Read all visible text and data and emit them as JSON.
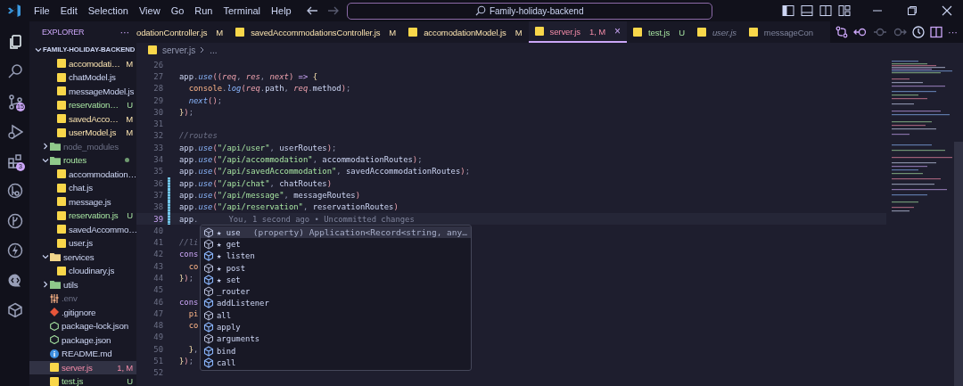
{
  "title_bar": {
    "menu": [
      "File",
      "Edit",
      "Selection",
      "View",
      "Go",
      "Run",
      "Terminal",
      "Help"
    ],
    "search": "Family-holiday-backend"
  },
  "activity_bar": [
    {
      "kind": "files",
      "selected": true
    },
    {
      "kind": "search",
      "selected": false
    },
    {
      "kind": "branch",
      "selected": false,
      "badge": "15"
    },
    {
      "kind": "debug",
      "selected": false
    },
    {
      "kind": "extensions",
      "selected": false,
      "badge": "3"
    },
    {
      "kind": "remote",
      "selected": false
    },
    {
      "kind": "graph",
      "selected": false
    },
    {
      "kind": "lightning",
      "selected": false
    },
    {
      "kind": "bubble",
      "selected": false
    },
    {
      "kind": "gem",
      "selected": false
    }
  ],
  "sidebar": {
    "title": "EXPLORER",
    "more": "···",
    "root": {
      "label": "FAMILY-HOLIDAY-BACKEND",
      "expanded": true,
      "children": [
        {
          "children": [
            {
              "label": "accomodati…",
              "kind": "js",
              "modified": true,
              "untracked": false,
              "error": false,
              "ignored": false,
              "status": "M",
              "selected": false
            },
            {
              "label": "chatModel.js",
              "kind": "js",
              "modified": false,
              "untracked": false,
              "error": false,
              "ignored": false,
              "selected": false
            },
            {
              "label": "messageModel.js",
              "kind": "js",
              "modified": false,
              "untracked": false,
              "error": false,
              "ignored": false,
              "selected": false
            },
            {
              "label": "reservation…",
              "kind": "js",
              "modified": false,
              "untracked": true,
              "error": false,
              "ignored": false,
              "status": "U",
              "selected": false
            },
            {
              "label": "savedAcco…",
              "kind": "js",
              "modified": true,
              "untracked": false,
              "error": false,
              "ignored": false,
              "status": "M",
              "selected": false
            },
            {
              "label": "userModel.js",
              "kind": "js",
              "modified": true,
              "untracked": false,
              "error": false,
              "ignored": false,
              "status": "M",
              "selected": false
            }
          ]
        },
        {
          "label": "node_modules",
          "kind": "folder",
          "color": "#8fc98a",
          "modified": false,
          "untracked": false,
          "error": false,
          "ignored": true,
          "expanded": false,
          "selected": false
        },
        {
          "label": "routes",
          "kind": "folder",
          "color": "#8fc98a",
          "modified": false,
          "untracked": true,
          "error": false,
          "ignored": false,
          "expanded": true,
          "dot": true,
          "selected": false,
          "children": [
            {
              "label": "accommodation…",
              "kind": "js",
              "modified": false,
              "untracked": false,
              "error": false,
              "ignored": false,
              "selected": false
            },
            {
              "label": "chat.js",
              "kind": "js",
              "modified": false,
              "untracked": false,
              "error": false,
              "ignored": false,
              "selected": false
            },
            {
              "label": "message.js",
              "kind": "js",
              "modified": false,
              "untracked": false,
              "error": false,
              "ignored": false,
              "selected": false
            },
            {
              "label": "reservation.js",
              "kind": "js",
              "modified": false,
              "untracked": true,
              "error": false,
              "ignored": false,
              "status": "U",
              "selected": false
            },
            {
              "label": "savedAccommo…",
              "kind": "js",
              "modified": false,
              "untracked": false,
              "error": false,
              "ignored": false,
              "selected": false
            },
            {
              "label": "user.js",
              "kind": "js",
              "modified": false,
              "untracked": false,
              "error": false,
              "ignored": false,
              "selected": false
            }
          ]
        },
        {
          "label": "services",
          "kind": "folder",
          "color": "#f2d58a",
          "modified": false,
          "untracked": false,
          "error": false,
          "ignored": false,
          "expanded": true,
          "selected": false,
          "children": [
            {
              "label": "cloudinary.js",
              "kind": "js",
              "modified": false,
              "untracked": false,
              "error": false,
              "ignored": false,
              "selected": false
            }
          ]
        },
        {
          "label": "utils",
          "kind": "folder",
          "color": "#8fc98a",
          "modified": false,
          "untracked": false,
          "error": false,
          "ignored": false,
          "expanded": false,
          "selected": false
        },
        {
          "label": ".env",
          "kind": "env",
          "modified": false,
          "untracked": false,
          "error": false,
          "ignored": true,
          "selected": false
        },
        {
          "label": ".gitignore",
          "kind": "git",
          "modified": false,
          "untracked": false,
          "error": false,
          "ignored": false,
          "selected": false
        },
        {
          "label": "package-lock.json",
          "kind": "npm",
          "modified": false,
          "untracked": false,
          "error": false,
          "ignored": false,
          "selected": false
        },
        {
          "label": "package.json",
          "kind": "npm",
          "modified": false,
          "untracked": false,
          "error": false,
          "ignored": false,
          "selected": false
        },
        {
          "label": "README.md",
          "kind": "info",
          "modified": false,
          "untracked": false,
          "error": false,
          "ignored": false,
          "selected": false
        },
        {
          "label": "server.js",
          "kind": "js",
          "modified": true,
          "untracked": false,
          "error": true,
          "ignored": false,
          "status": "1, M",
          "selected": true
        },
        {
          "label": "test.js",
          "kind": "js",
          "modified": false,
          "untracked": true,
          "error": false,
          "ignored": false,
          "status": "U",
          "selected": false
        }
      ]
    }
  },
  "tabs": [
    {
      "label": "odationController.js",
      "kind": "plain",
      "modified": true,
      "untracked": false,
      "error": false,
      "status": "M",
      "preview": false,
      "selected": false
    },
    {
      "label": "savedAccommodationsController.js",
      "kind": "js",
      "modified": true,
      "untracked": false,
      "error": false,
      "status": "M",
      "preview": false,
      "selected": false
    },
    {
      "label": "accomodationModel.js",
      "kind": "js",
      "modified": true,
      "untracked": false,
      "error": false,
      "status": "M",
      "preview": false,
      "selected": false
    },
    {
      "label": "server.js",
      "kind": "js",
      "modified": true,
      "untracked": false,
      "error": true,
      "status": "1, M",
      "preview": false,
      "selected": true,
      "close": "×"
    },
    {
      "label": "test.js",
      "kind": "js",
      "modified": false,
      "untracked": true,
      "error": false,
      "status": "U",
      "preview": false,
      "selected": false
    },
    {
      "label": "user.js",
      "kind": "js",
      "modified": false,
      "untracked": false,
      "error": false,
      "preview": true,
      "selected": false
    },
    {
      "label": "messageCon",
      "kind": "js",
      "modified": false,
      "untracked": false,
      "error": false,
      "preview": false,
      "selected": false
    }
  ],
  "editor_actions": {
    "more": "···"
  },
  "breadcrumb": {
    "file": "server.js",
    "rest": "..."
  },
  "editor": {
    "lines": [
      {
        "number": "26",
        "current": false
      },
      {
        "number": "27",
        "current": false,
        "tokens": [
          {
            "kind": "plain",
            "text": "app"
          },
          {
            "kind": "punc",
            "text": "."
          },
          {
            "kind": "fn",
            "text": "use"
          },
          {
            "kind": "paren",
            "text": "(("
          },
          {
            "kind": "param",
            "text": "req"
          },
          {
            "kind": "punc",
            "text": ", "
          },
          {
            "kind": "param",
            "text": "res"
          },
          {
            "kind": "punc",
            "text": ", "
          },
          {
            "kind": "param",
            "text": "next"
          },
          {
            "kind": "paren",
            "text": ")"
          },
          {
            "kind": "op",
            "text": " => "
          },
          {
            "kind": "brace",
            "text": "{"
          }
        ]
      },
      {
        "number": "28",
        "current": false,
        "indented": true,
        "tokens": [
          {
            "kind": "obj",
            "text": "console"
          },
          {
            "kind": "punc",
            "text": "."
          },
          {
            "kind": "fn",
            "text": "log"
          },
          {
            "kind": "paren",
            "text": "("
          },
          {
            "kind": "param",
            "text": "req"
          },
          {
            "kind": "punc",
            "text": "."
          },
          {
            "kind": "plain",
            "text": "path"
          },
          {
            "kind": "punc",
            "text": ", "
          },
          {
            "kind": "param",
            "text": "req"
          },
          {
            "kind": "punc",
            "text": "."
          },
          {
            "kind": "plain",
            "text": "method"
          },
          {
            "kind": "paren",
            "text": ")"
          },
          {
            "kind": "punc",
            "text": ";"
          }
        ]
      },
      {
        "number": "29",
        "current": false,
        "indented": true,
        "tokens": [
          {
            "kind": "fn",
            "text": "next"
          },
          {
            "kind": "paren",
            "text": "()"
          },
          {
            "kind": "punc",
            "text": ";"
          }
        ]
      },
      {
        "number": "30",
        "current": false,
        "tokens": [
          {
            "kind": "brace",
            "text": "}"
          },
          {
            "kind": "paren",
            "text": ")"
          },
          {
            "kind": "punc",
            "text": ";"
          }
        ]
      },
      {
        "number": "31",
        "current": false
      },
      {
        "number": "32",
        "current": false,
        "tokens": [
          {
            "kind": "comment",
            "text": "//routes"
          }
        ]
      },
      {
        "number": "33",
        "current": false,
        "tokens": [
          {
            "kind": "plain",
            "text": "app"
          },
          {
            "kind": "punc",
            "text": "."
          },
          {
            "kind": "fn",
            "text": "use"
          },
          {
            "kind": "paren",
            "text": "("
          },
          {
            "kind": "str",
            "text": "\"/api/user\""
          },
          {
            "kind": "punc",
            "text": ", "
          },
          {
            "kind": "plain",
            "text": "userRoutes"
          },
          {
            "kind": "paren",
            "text": ")"
          },
          {
            "kind": "punc",
            "text": ";"
          }
        ]
      },
      {
        "number": "34",
        "current": false,
        "tokens": [
          {
            "kind": "plain",
            "text": "app"
          },
          {
            "kind": "punc",
            "text": "."
          },
          {
            "kind": "fn",
            "text": "use"
          },
          {
            "kind": "paren",
            "text": "("
          },
          {
            "kind": "str",
            "text": "\"/api/accommodation\""
          },
          {
            "kind": "punc",
            "text": ", "
          },
          {
            "kind": "plain",
            "text": "accommodationRoutes"
          },
          {
            "kind": "paren",
            "text": ")"
          },
          {
            "kind": "punc",
            "text": ";"
          }
        ]
      },
      {
        "number": "35",
        "current": false,
        "tokens": [
          {
            "kind": "plain",
            "text": "app"
          },
          {
            "kind": "punc",
            "text": "."
          },
          {
            "kind": "fn",
            "text": "use"
          },
          {
            "kind": "paren",
            "text": "("
          },
          {
            "kind": "str",
            "text": "\"/api/savedAccommodation\""
          },
          {
            "kind": "punc",
            "text": ", "
          },
          {
            "kind": "plain",
            "text": "savedAccommodationRoutes"
          },
          {
            "kind": "paren",
            "text": ")"
          },
          {
            "kind": "punc",
            "text": ";"
          }
        ]
      },
      {
        "number": "36",
        "current": false,
        "changed": true,
        "tokens": [
          {
            "kind": "plain",
            "text": "app"
          },
          {
            "kind": "punc",
            "text": "."
          },
          {
            "kind": "fn",
            "text": "use"
          },
          {
            "kind": "paren",
            "text": "("
          },
          {
            "kind": "str",
            "text": "\"/api/chat\""
          },
          {
            "kind": "punc",
            "text": ", "
          },
          {
            "kind": "plain",
            "text": "chatRoutes"
          },
          {
            "kind": "paren",
            "text": ")"
          }
        ]
      },
      {
        "number": "37",
        "current": false,
        "changed": true,
        "tokens": [
          {
            "kind": "plain",
            "text": "app"
          },
          {
            "kind": "punc",
            "text": "."
          },
          {
            "kind": "fn",
            "text": "use"
          },
          {
            "kind": "paren",
            "text": "("
          },
          {
            "kind": "str",
            "text": "\"/api/message\""
          },
          {
            "kind": "punc",
            "text": ", "
          },
          {
            "kind": "plain",
            "text": "messageRoutes"
          },
          {
            "kind": "paren",
            "text": ")"
          }
        ]
      },
      {
        "number": "38",
        "current": false,
        "changed": true,
        "tokens": [
          {
            "kind": "plain",
            "text": "app"
          },
          {
            "kind": "punc",
            "text": "."
          },
          {
            "kind": "fn",
            "text": "use"
          },
          {
            "kind": "paren",
            "text": "("
          },
          {
            "kind": "str",
            "text": "\"/api/reservation\""
          },
          {
            "kind": "punc",
            "text": ", "
          },
          {
            "kind": "plain",
            "text": "reservationRoutes"
          },
          {
            "kind": "paren",
            "text": ")"
          }
        ]
      },
      {
        "number": "39",
        "current": true,
        "changed": true,
        "tokens": [
          {
            "kind": "plain",
            "text": "app"
          },
          {
            "kind": "punc",
            "text": "."
          }
        ],
        "blame": "You, 1 second ago • Uncommitted changes"
      },
      {
        "number": "40",
        "current": false
      },
      {
        "number": "41",
        "current": false,
        "tokens": [
          {
            "kind": "comment",
            "text": "//li"
          }
        ]
      },
      {
        "number": "42",
        "current": false,
        "tokens": [
          {
            "kind": "kw",
            "text": "cons"
          }
        ]
      },
      {
        "number": "43",
        "current": false,
        "indented": true,
        "tokens": [
          {
            "kind": "obj",
            "text": "co"
          }
        ]
      },
      {
        "number": "44",
        "current": false,
        "tokens": [
          {
            "kind": "brace",
            "text": "}"
          },
          {
            "kind": "paren",
            "text": ")"
          },
          {
            "kind": "punc",
            "text": ";"
          }
        ]
      },
      {
        "number": "45",
        "current": false
      },
      {
        "number": "46",
        "current": false,
        "tokens": [
          {
            "kind": "kw",
            "text": "cons"
          }
        ]
      },
      {
        "number": "47",
        "current": false,
        "indented": true,
        "tokens": [
          {
            "kind": "obj",
            "text": "pi"
          }
        ]
      },
      {
        "number": "48",
        "current": false,
        "indented": true,
        "tokens": [
          {
            "kind": "obj",
            "text": "co"
          }
        ]
      },
      {
        "number": "49",
        "current": false
      },
      {
        "number": "50",
        "current": false,
        "indented": true,
        "tokens": [
          {
            "kind": "brace",
            "text": "}"
          },
          {
            "kind": "punc",
            "text": ","
          }
        ]
      },
      {
        "number": "51",
        "current": false,
        "tokens": [
          {
            "kind": "brace",
            "text": "}"
          },
          {
            "kind": "paren",
            "text": ")"
          },
          {
            "kind": "punc",
            "text": ";"
          }
        ]
      },
      {
        "number": "52",
        "current": false
      }
    ],
    "suggest": {
      "items": [
        {
          "label": "★ use",
          "kind": "property",
          "selected": true,
          "detail": "(property) Application<Record<string, any…"
        },
        {
          "label": "★ get",
          "kind": "property",
          "selected": false
        },
        {
          "label": "★ listen",
          "kind": "method",
          "selected": false
        },
        {
          "label": "★ post",
          "kind": "property",
          "selected": false
        },
        {
          "label": "★ set",
          "kind": "method",
          "selected": false
        },
        {
          "label": "_router",
          "kind": "property",
          "selected": false
        },
        {
          "label": "addListener",
          "kind": "method",
          "selected": false
        },
        {
          "label": "all",
          "kind": "property",
          "selected": false
        },
        {
          "label": "apply",
          "kind": "method",
          "selected": false
        },
        {
          "label": "arguments",
          "kind": "property",
          "selected": false
        },
        {
          "label": "bind",
          "kind": "method",
          "selected": false
        },
        {
          "label": "call",
          "kind": "method",
          "selected": false
        }
      ]
    }
  }
}
